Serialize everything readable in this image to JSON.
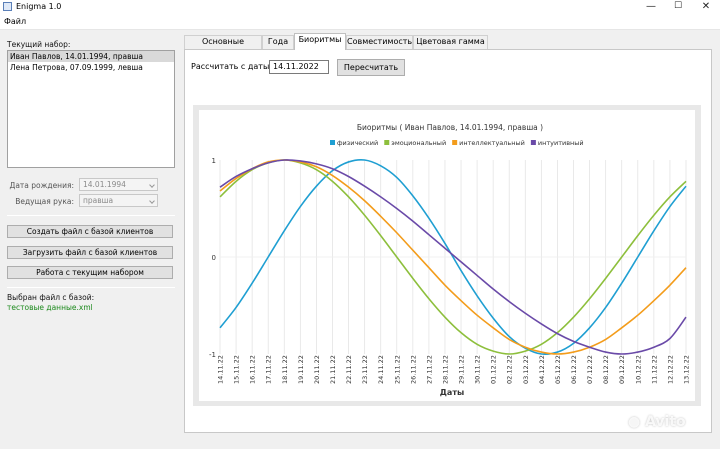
{
  "window": {
    "title": "Enigma 1.0",
    "minimize": "—",
    "maximize": "☐",
    "close": "✕"
  },
  "menu": {
    "file": "Файл"
  },
  "left": {
    "current_set_label": "Текущий набор:",
    "clients": [
      {
        "text": "Иван Павлов, 14.01.1994, правша",
        "selected": true
      },
      {
        "text": "Лена Петрова, 07.09.1999, левша",
        "selected": false
      }
    ],
    "birth_date_label": "Дата рождения:",
    "birth_date_value": "14.01.1994",
    "hand_label": "Ведущая рука:",
    "hand_value": "правша",
    "create_btn": "Создать файл с базой клиентов",
    "load_btn": "Загрузить файл с базой клиентов",
    "work_btn": "Работа с текущим набором",
    "selected_file_label": "Выбран файл с базой:",
    "selected_file_value": "тестовые данные.xml"
  },
  "tabs": [
    {
      "label": "Основные данные",
      "active": false
    },
    {
      "label": "Года",
      "active": false
    },
    {
      "label": "Биоритмы",
      "active": true
    },
    {
      "label": "Совместимость",
      "active": false
    },
    {
      "label": "Цветовая гамма",
      "active": false
    }
  ],
  "biorhythm": {
    "date_label": "Рассчитать с даты:",
    "date_value": "14.11.2022",
    "recalc_btn": "Пересчитать"
  },
  "chart_data": {
    "type": "line",
    "title": "Биоритмы ( Иван Павлов, 14.01.1994, правша )",
    "xlabel": "Даты",
    "ylabel": "",
    "ylim": [
      -1,
      1
    ],
    "yticks": [
      "1",
      "0",
      "-1"
    ],
    "grid": "vertical",
    "legend_position": "top",
    "x": [
      "14.11.22",
      "15.11.22",
      "16.11.22",
      "17.11.22",
      "18.11.22",
      "19.11.22",
      "20.11.22",
      "21.11.22",
      "22.11.22",
      "23.11.22",
      "24.11.22",
      "25.11.22",
      "26.11.22",
      "27.11.22",
      "28.11.22",
      "29.11.22",
      "30.11.22",
      "01.12.22",
      "02.12.22",
      "03.12.22",
      "04.12.22",
      "05.12.22",
      "06.12.22",
      "07.12.22",
      "08.12.22",
      "09.12.22",
      "10.12.22",
      "11.12.22",
      "12.12.22",
      "13.12.22"
    ],
    "series": [
      {
        "name": "физический",
        "color": "#1f9fd2",
        "values": [
          -0.73,
          -0.52,
          -0.27,
          0.0,
          0.27,
          0.52,
          0.73,
          0.89,
          0.98,
          1.0,
          0.94,
          0.82,
          0.63,
          0.4,
          0.14,
          -0.14,
          -0.4,
          -0.63,
          -0.82,
          -0.94,
          -1.0,
          -0.98,
          -0.89,
          -0.73,
          -0.52,
          -0.27,
          0.0,
          0.27,
          0.52,
          0.73
        ]
      },
      {
        "name": "эмоциональный",
        "color": "#8dbf3c",
        "values": [
          0.62,
          0.78,
          0.9,
          0.97,
          1.0,
          0.97,
          0.9,
          0.78,
          0.62,
          0.43,
          0.22,
          0.0,
          -0.22,
          -0.43,
          -0.62,
          -0.78,
          -0.9,
          -0.97,
          -1.0,
          -0.97,
          -0.9,
          -0.78,
          -0.62,
          -0.43,
          -0.22,
          0.0,
          0.22,
          0.43,
          0.62,
          0.78
        ]
      },
      {
        "name": "интеллектуальный",
        "color": "#f39c1b",
        "values": [
          0.68,
          0.81,
          0.91,
          0.98,
          1.0,
          0.98,
          0.93,
          0.84,
          0.72,
          0.58,
          0.42,
          0.25,
          0.07,
          -0.11,
          -0.29,
          -0.45,
          -0.6,
          -0.73,
          -0.85,
          -0.93,
          -0.98,
          -1.0,
          -0.98,
          -0.93,
          -0.85,
          -0.73,
          -0.6,
          -0.45,
          -0.29,
          -0.11
        ]
      },
      {
        "name": "интуитивный",
        "color": "#6a4aa8",
        "values": [
          0.72,
          0.83,
          0.91,
          0.97,
          1.0,
          0.99,
          0.96,
          0.91,
          0.83,
          0.73,
          0.62,
          0.5,
          0.37,
          0.23,
          0.09,
          -0.05,
          -0.19,
          -0.33,
          -0.46,
          -0.58,
          -0.69,
          -0.79,
          -0.87,
          -0.93,
          -0.98,
          -1.0,
          -0.98,
          -0.93,
          -0.84,
          -0.62
        ]
      }
    ]
  }
}
